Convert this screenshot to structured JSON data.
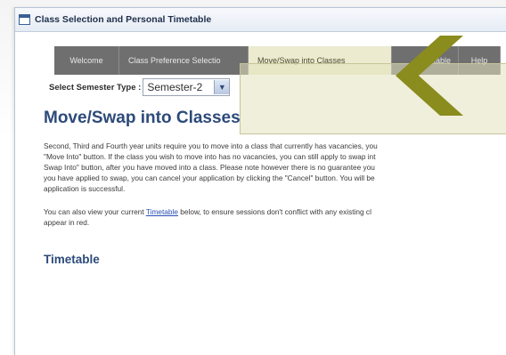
{
  "window": {
    "title": "Class Selection and Personal Timetable"
  },
  "tabs": [
    {
      "label": "Welcome",
      "active": false
    },
    {
      "label": "Class Preference Selectio",
      "active": false
    },
    {
      "label": "Move/Swap into Classes",
      "active": true
    },
    {
      "label": "imetable",
      "active": false
    },
    {
      "label": "Help",
      "active": false
    }
  ],
  "semester": {
    "label": "Select Semester Type :",
    "selected": "Semester-2"
  },
  "main": {
    "heading": "Move/Swap into Classes",
    "paragraph1_lines": [
      "Second, Third and Fourth year units require you to move into a class that currently has vacancies, you",
      "\"Move Into\" button. If the class you wish to move into has no vacancies, you can still apply to swap int",
      "Swap Into\" button, after you have moved into a class. Please note however there is no guarantee you",
      "you have applied to swap, you can cancel your application by clicking the \"Cancel\" button. You will be",
      "application is successful."
    ],
    "paragraph2": {
      "before": "You can also view your current ",
      "link": "Timetable",
      "after_line1": " below, to ensure sessions don't conflict with any existing cl",
      "line2": "appear in red."
    },
    "section_heading": "Timetable"
  },
  "colors": {
    "accent": "#2d4a7a",
    "tab_inactive": "#6f6f6f",
    "tab_active": "#ecebcf",
    "arrow": "#8a8c1e"
  }
}
